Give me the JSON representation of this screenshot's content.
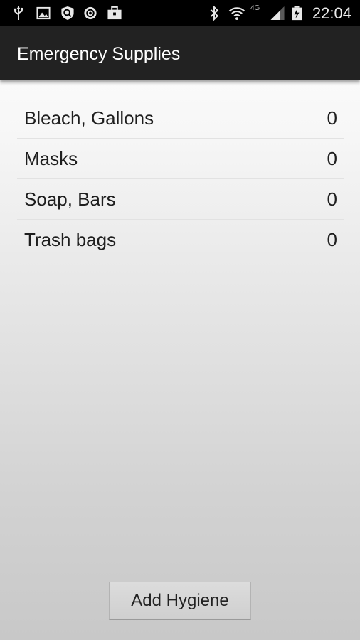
{
  "status_bar": {
    "time": "22:04",
    "network_label": "4G",
    "icons": [
      "usb-icon",
      "image-icon",
      "shield-icon",
      "sync-icon",
      "briefcase-icon",
      "bluetooth-icon",
      "wifi-icon",
      "signal-icon",
      "battery-charging-icon"
    ]
  },
  "app": {
    "title": "Emergency Supplies"
  },
  "supplies": [
    {
      "name": "Bleach, Gallons",
      "count": "0"
    },
    {
      "name": "Masks",
      "count": "0"
    },
    {
      "name": "Soap, Bars",
      "count": "0"
    },
    {
      "name": "Trash bags",
      "count": "0"
    }
  ],
  "actions": {
    "add_label": "Add Hygiene"
  },
  "colors": {
    "status_bar": "#000000",
    "action_bar": "#222222",
    "text": "#1e1e1e"
  }
}
